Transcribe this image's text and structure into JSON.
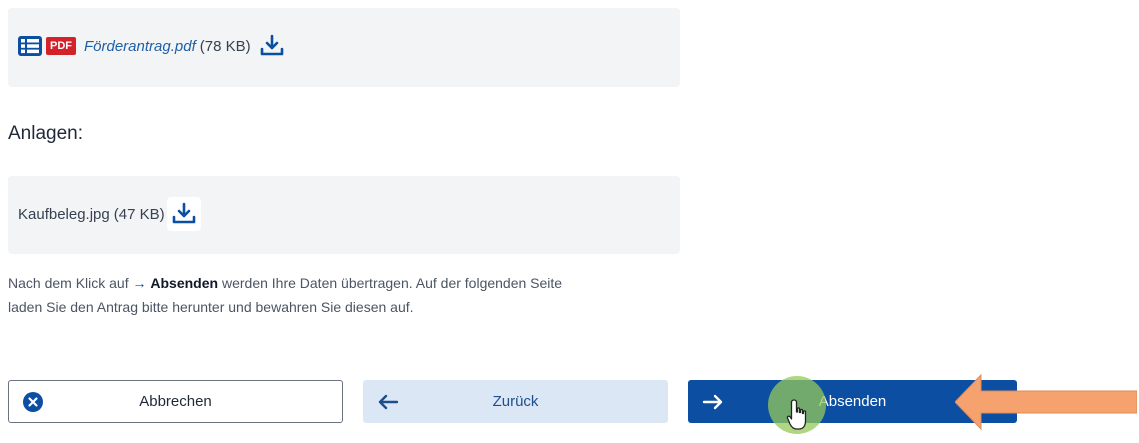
{
  "form_file": {
    "type_badge": "PDF",
    "filename": "Förderantrag.pdf",
    "size": "(78 KB)"
  },
  "attachments": {
    "heading": "Anlagen:",
    "items": [
      {
        "filename": "Kaufbeleg.jpg",
        "size": "(47 KB)"
      }
    ]
  },
  "info": {
    "prefix": "Nach dem Klick auf",
    "action": "Absenden",
    "line1_suffix": "werden Ihre Daten übertragen. Auf der folgenden Seite",
    "line2": "laden Sie den Antrag bitte herunter und bewahren Sie diesen auf."
  },
  "buttons": {
    "cancel": "Abbrechen",
    "back": "Zurück",
    "submit": "Absenden"
  },
  "colors": {
    "primary": "#0b4ea2",
    "secondary_bg": "#dbe7f5",
    "pdf_red": "#d3222a",
    "annotation_orange": "#f5a26f",
    "cursor_highlight": "#96c85a"
  }
}
